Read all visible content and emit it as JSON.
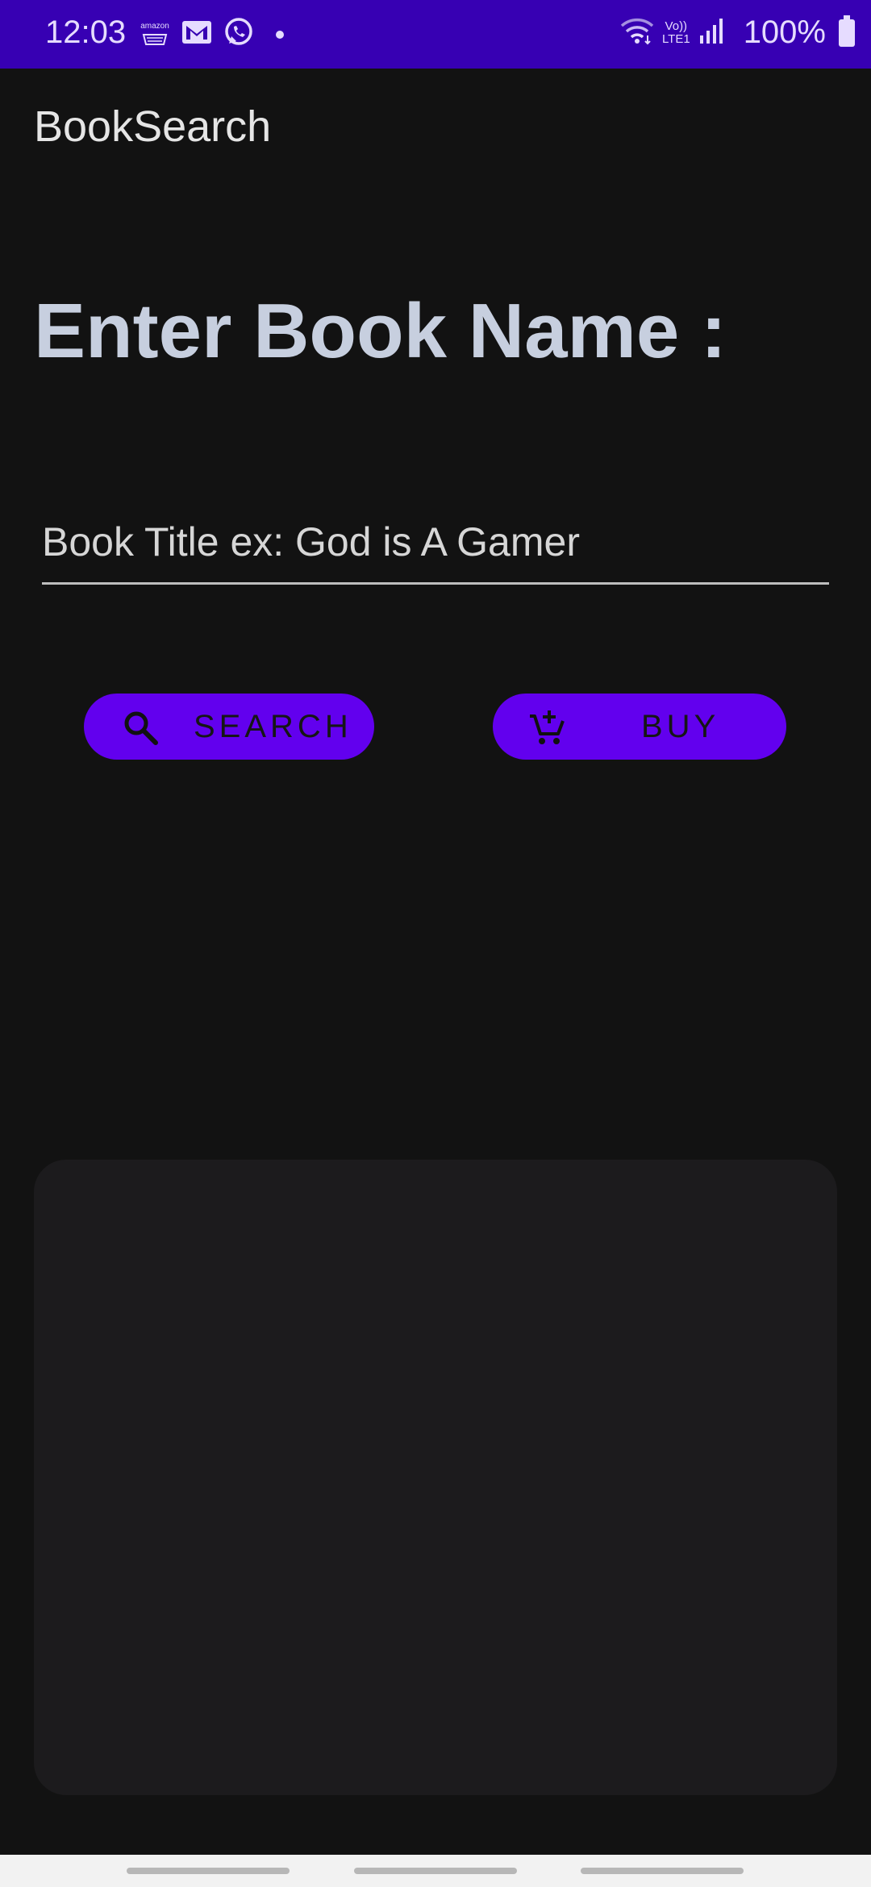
{
  "status_bar": {
    "time": "12:03",
    "notification_icons": [
      "amazon-icon",
      "gmail-icon",
      "whatsapp-icon",
      "dot-icon"
    ],
    "amazon_label": "amazon",
    "network_label_top": "Vo))",
    "network_label_bottom": "LTE1",
    "battery": "100%"
  },
  "app_bar": {
    "title": "BookSearch"
  },
  "main": {
    "heading": "Enter Book Name :",
    "book_input": {
      "value": "",
      "placeholder": "Book Title ex: God is A Gamer"
    },
    "search_button": {
      "label": "SEARCH",
      "icon": "search-icon"
    },
    "buy_button": {
      "label": "BUY",
      "icon": "add-to-cart-icon"
    }
  },
  "colors": {
    "status_bar": "#3700b3",
    "background": "#121212",
    "button": "#6200ee",
    "card": "#1c1b1d",
    "heading": "#c7cfdf"
  }
}
